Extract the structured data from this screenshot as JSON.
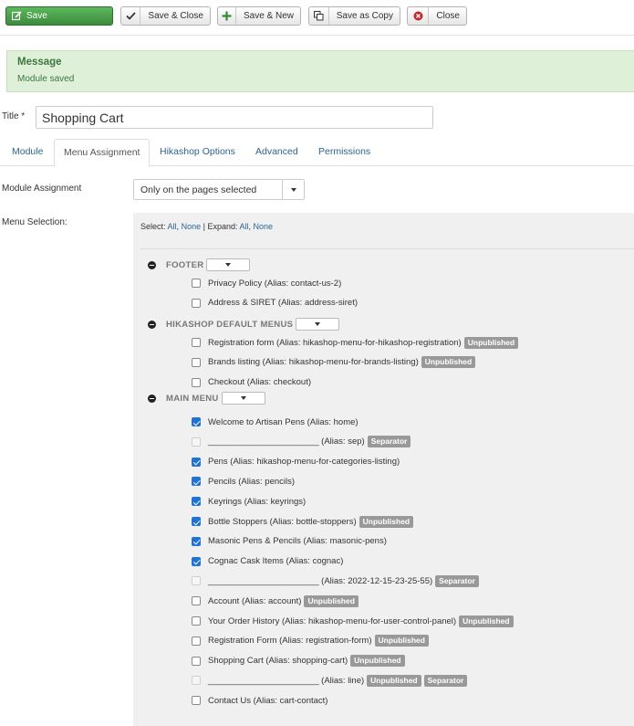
{
  "toolbar": {
    "save": "Save",
    "save_close": "Save & Close",
    "save_new": "Save & New",
    "save_copy": "Save as Copy",
    "close": "Close"
  },
  "message": {
    "title": "Message",
    "text": "Module saved"
  },
  "form": {
    "title_label": "Title *",
    "title_value": "Shopping Cart",
    "module_assignment_label": "Module Assignment",
    "module_assignment_value": "Only on the pages selected",
    "menu_selection_label": "Menu Selection:"
  },
  "tabs": [
    {
      "label": "Module"
    },
    {
      "label": "Menu Assignment"
    },
    {
      "label": "Hikashop Options"
    },
    {
      "label": "Advanced"
    },
    {
      "label": "Permissions"
    }
  ],
  "panel": {
    "select_prefix": "Select:",
    "all": "All",
    "none": "None",
    "expand_prefix": "| Expand:",
    "comma": ","
  },
  "groups": [
    {
      "name": "FOOTER",
      "items": [
        {
          "label": "Privacy Policy (Alias: contact-us-2)",
          "checked": false,
          "disabled": false,
          "badges": []
        },
        {
          "label": "Address & SIRET (Alias: address-siret)",
          "checked": false,
          "disabled": false,
          "badges": []
        }
      ]
    },
    {
      "name": "HIKASHOP DEFAULT MENUS",
      "items": [
        {
          "label": "Registration form (Alias: hikashop-menu-for-hikashop-registration)",
          "checked": false,
          "disabled": false,
          "badges": [
            "Unpublished"
          ]
        },
        {
          "label": "Brands listing (Alias: hikashop-menu-for-brands-listing)",
          "checked": false,
          "disabled": false,
          "badges": [
            "Unpublished"
          ]
        },
        {
          "label": "Checkout (Alias: checkout)",
          "checked": false,
          "disabled": false,
          "badges": []
        }
      ]
    },
    {
      "name": "MAIN MENU",
      "items": [
        {
          "label": "Welcome to Artisan Pens (Alias: home)",
          "checked": true,
          "disabled": false,
          "badges": []
        },
        {
          "label": "_______________________ (Alias: sep)",
          "checked": false,
          "disabled": true,
          "badges": [
            "Separator"
          ]
        },
        {
          "label": "Pens (Alias: hikashop-menu-for-categories-listing)",
          "checked": true,
          "disabled": false,
          "badges": []
        },
        {
          "label": "Pencils (Alias: pencils)",
          "checked": true,
          "disabled": false,
          "badges": []
        },
        {
          "label": "Keyrings (Alias: keyrings)",
          "checked": true,
          "disabled": false,
          "badges": []
        },
        {
          "label": "Bottle Stoppers (Alias: bottle-stoppers)",
          "checked": true,
          "disabled": false,
          "badges": [
            "Unpublished"
          ]
        },
        {
          "label": "Masonic Pens & Pencils (Alias: masonic-pens)",
          "checked": true,
          "disabled": false,
          "badges": []
        },
        {
          "label": "Cognac Cask Items (Alias: cognac)",
          "checked": true,
          "disabled": false,
          "badges": []
        },
        {
          "label": "_______________________ (Alias: 2022-12-15-23-25-55)",
          "checked": false,
          "disabled": true,
          "badges": [
            "Separator"
          ]
        },
        {
          "label": "Account (Alias: account)",
          "checked": false,
          "disabled": false,
          "badges": [
            "Unpublished"
          ]
        },
        {
          "label": "Your Order History (Alias: hikashop-menu-for-user-control-panel)",
          "checked": false,
          "disabled": false,
          "badges": [
            "Unpublished"
          ]
        },
        {
          "label": "Registration Form (Alias: registration-form)",
          "checked": false,
          "disabled": false,
          "badges": [
            "Unpublished"
          ]
        },
        {
          "label": "Shopping Cart (Alias: shopping-cart)",
          "checked": false,
          "disabled": false,
          "badges": [
            "Unpublished"
          ]
        },
        {
          "label": "_______________________ (Alias: line)",
          "checked": false,
          "disabled": true,
          "badges": [
            "Unpublished",
            "Separator"
          ]
        },
        {
          "label": "Contact Us (Alias: cart-contact)",
          "checked": false,
          "disabled": false,
          "badges": []
        }
      ]
    }
  ]
}
